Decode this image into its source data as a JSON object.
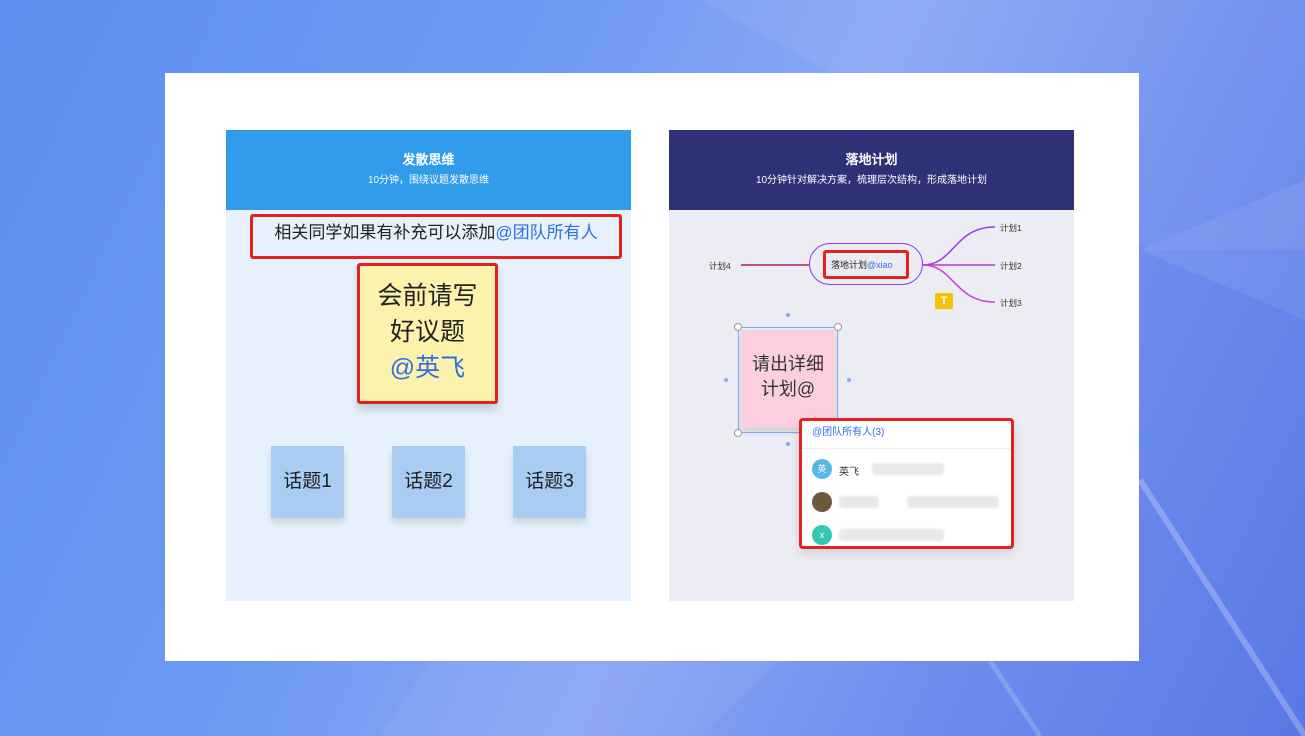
{
  "left_panel": {
    "title": "发散思维",
    "subtitle": "10分钟，围绕议题发散思维",
    "hint_text": "相关同学如果有补充可以添加",
    "hint_mention": "@团队所有人",
    "main_note_line1": "会前请写",
    "main_note_line2": "好议题",
    "main_note_mention": "@英飞",
    "topics": [
      "话题1",
      "话题2",
      "话题3"
    ]
  },
  "right_panel": {
    "title": "落地计划",
    "subtitle": "10分钟针对解决方案，梳理层次结构，形成落地计划",
    "mindmap": {
      "center_text": "落地计划",
      "center_mention": "@xiao",
      "leaves": [
        "计划1",
        "计划2",
        "计划3",
        "计划4"
      ]
    },
    "text_tool_icon": "T",
    "pink_note_line1": "请出详细",
    "pink_note_line2": "计划@",
    "mention_popup": {
      "title": "@团队所有人(3)",
      "members": [
        {
          "avatar_text": "英",
          "name": "英飞",
          "avatar_color": "#5bb6e8"
        },
        {
          "avatar_text": "",
          "name": "",
          "avatar_color": "#6b5a3a"
        },
        {
          "avatar_text": "x",
          "name": "",
          "avatar_color": "#36c7b2"
        }
      ]
    }
  },
  "colors": {
    "highlight_red": "#e3221c",
    "mention_blue": "#2f6fe0",
    "left_header": "#2f9bea",
    "right_header": "#2e3176"
  }
}
